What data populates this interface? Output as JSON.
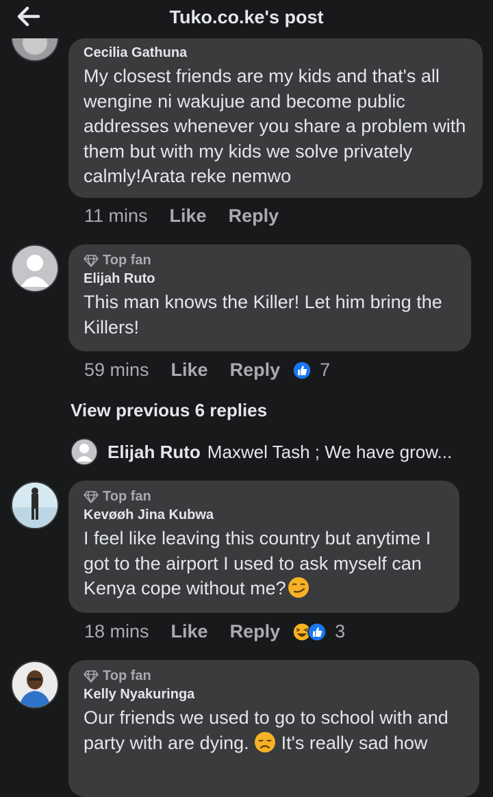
{
  "header": {
    "title": "Tuko.co.ke's post"
  },
  "comments": [
    {
      "author": "Cecilia Gathuna",
      "text": "My closest friends are my kids and that's all wengine ni wakujue and become public addresses whenever you share a problem with them but with my kids we solve privately calmly!Arata reke nemwo",
      "time": "11 mins",
      "like": "Like",
      "reply": "Reply"
    },
    {
      "badge": "Top fan",
      "author": "Elijah Ruto",
      "text": "This man knows the Killer! Let him bring the Killers!",
      "time": "59 mins",
      "like": "Like",
      "reply": "Reply",
      "reactions": "7"
    },
    {
      "badge": "Top fan",
      "author": "Kevøøh Jina Kubwa",
      "text": "I feel like leaving this country but anytime I got to the airport I used to ask myself can Kenya cope without me?",
      "time": "18 mins",
      "like": "Like",
      "reply": "Reply",
      "reactions": "3"
    },
    {
      "badge": "Top fan",
      "author": "Kelly Nyakuringa",
      "text_a": "Our friends we used to go to school with and party with are dying.",
      "text_b": "It's really sad how"
    }
  ],
  "view_previous": "View previous 6 replies",
  "reply_preview": {
    "author": "Elijah Ruto",
    "text": "Maxwel Tash ; We have grow..."
  },
  "colors": {
    "bg": "#18191a",
    "bubble": "#3a3b3c",
    "like_blue": "#1877f2",
    "haha_yellow": "#f7b125"
  }
}
